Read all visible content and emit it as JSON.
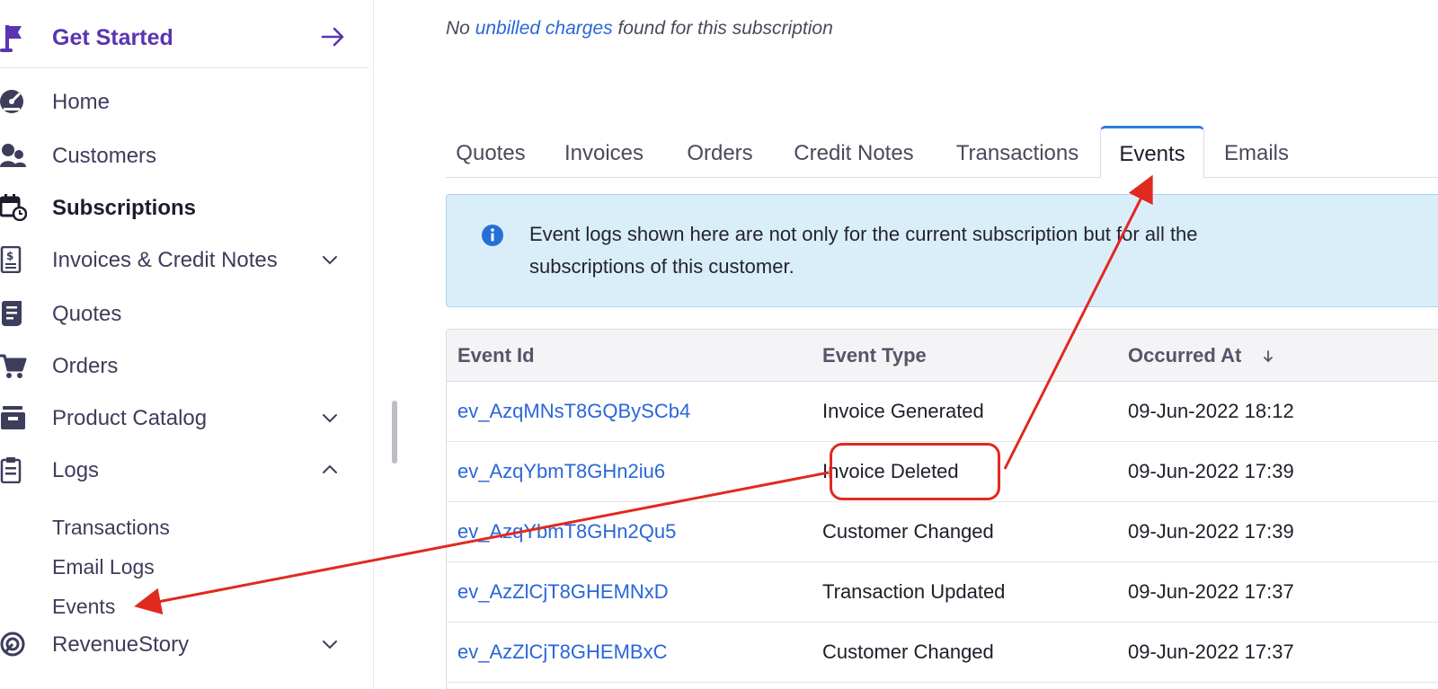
{
  "sidebar": {
    "get_started": {
      "label": "Get Started",
      "icon": "flag-icon",
      "arrow_icon": "arrow-right-icon"
    },
    "items": [
      {
        "label": "Home",
        "icon": "dashboard-icon",
        "active": false,
        "expandable": false
      },
      {
        "label": "Customers",
        "icon": "customers-icon",
        "active": false,
        "expandable": false
      },
      {
        "label": "Subscriptions",
        "icon": "calendar-clock-icon",
        "active": true,
        "expandable": false
      },
      {
        "label": "Invoices & Credit Notes",
        "icon": "invoice-icon",
        "active": false,
        "expandable": true,
        "expanded": false
      },
      {
        "label": "Quotes",
        "icon": "quotes-icon",
        "active": false,
        "expandable": false
      },
      {
        "label": "Orders",
        "icon": "cart-icon",
        "active": false,
        "expandable": false
      },
      {
        "label": "Product Catalog",
        "icon": "catalog-icon",
        "active": false,
        "expandable": true,
        "expanded": false
      },
      {
        "label": "Logs",
        "icon": "clipboard-icon",
        "active": false,
        "expandable": true,
        "expanded": true
      },
      {
        "label": "RevenueStory",
        "icon": "revenuestory-icon",
        "active": false,
        "expandable": true,
        "expanded": false
      }
    ],
    "logs_children": [
      "Transactions",
      "Email Logs",
      "Events"
    ]
  },
  "main": {
    "notice": {
      "prefix": "No ",
      "link": "unbilled charges",
      "suffix": " found for this subscription"
    },
    "tabs": [
      {
        "label": "Quotes",
        "active": false
      },
      {
        "label": "Invoices",
        "active": false
      },
      {
        "label": "Orders",
        "active": false
      },
      {
        "label": "Credit Notes",
        "active": false
      },
      {
        "label": "Transactions",
        "active": false
      },
      {
        "label": "Events",
        "active": true
      },
      {
        "label": "Emails",
        "active": false
      }
    ],
    "info": {
      "icon": "info-circle-icon",
      "text": "Event logs shown here are not only for the current subscription but for all the subscriptions of this customer."
    },
    "table": {
      "columns": [
        "Event Id",
        "Event Type",
        "Occurred At"
      ],
      "sort_icon": "arrow-down-icon",
      "rows": [
        {
          "id": "ev_AzqMNsT8GQBySCb4",
          "type": "Invoice Generated",
          "at": "09-Jun-2022 18:12"
        },
        {
          "id": "ev_AzqYbmT8GHn2iu6",
          "type": "Invoice Deleted",
          "at": "09-Jun-2022 17:39"
        },
        {
          "id": "ev_AzqYbmT8GHn2Qu5",
          "type": "Customer Changed",
          "at": "09-Jun-2022 17:39"
        },
        {
          "id": "ev_AzZlCjT8GHEMNxD",
          "type": "Transaction Updated",
          "at": "09-Jun-2022 17:37"
        },
        {
          "id": "ev_AzZlCjT8GHEMBxC",
          "type": "Customer Changed",
          "at": "09-Jun-2022 17:37"
        }
      ]
    }
  },
  "colors": {
    "accent_purple": "#5a35b0",
    "link_blue": "#2a66d8",
    "tab_active_border": "#2f7be0",
    "info_bg": "#daeefa",
    "annotation_red": "#e02a1f"
  }
}
